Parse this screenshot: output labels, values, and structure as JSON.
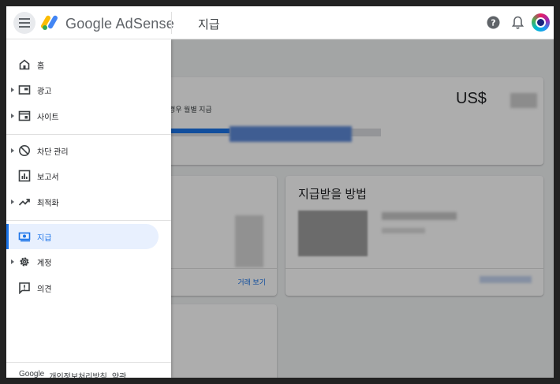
{
  "header": {
    "brand_google": "Google",
    "brand_product": "AdSense",
    "page_title": "지급"
  },
  "main": {
    "balance_note": "경우 월별 지급",
    "currency": "US$",
    "transactions_link": "거래 보기",
    "payment_method_title": "지급받을 방법"
  },
  "sidebar": {
    "items": [
      {
        "label": "홈",
        "icon": "home-icon",
        "expandable": false
      },
      {
        "label": "광고",
        "icon": "ads-icon",
        "expandable": true
      },
      {
        "label": "사이트",
        "icon": "sites-icon",
        "expandable": true
      },
      {
        "label": "차단 관리",
        "icon": "block-icon",
        "expandable": true
      },
      {
        "label": "보고서",
        "icon": "reports-icon",
        "expandable": false
      },
      {
        "label": "최적화",
        "icon": "optimization-icon",
        "expandable": true
      },
      {
        "label": "지급",
        "icon": "payments-icon",
        "expandable": false,
        "active": true
      },
      {
        "label": "계정",
        "icon": "account-gear-icon",
        "expandable": true
      },
      {
        "label": "의견",
        "icon": "feedback-icon",
        "expandable": false
      }
    ]
  },
  "footer": {
    "brand": "Google",
    "privacy": "개인정보처리방침",
    "terms": "약관"
  },
  "colors": {
    "accent": "#1a73e8",
    "active_bg": "#e8f0fe"
  }
}
